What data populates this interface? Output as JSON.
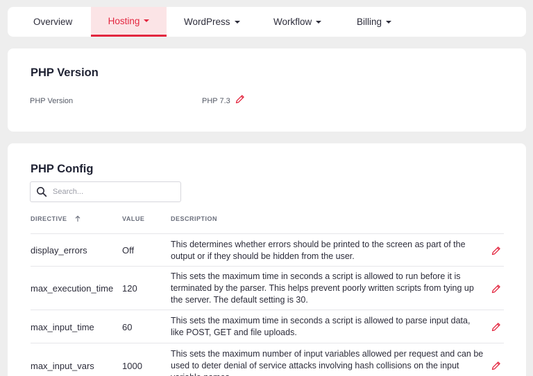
{
  "tabs": [
    {
      "label": "Overview",
      "dropdown": false,
      "active": false
    },
    {
      "label": "Hosting",
      "dropdown": true,
      "active": true
    },
    {
      "label": "WordPress",
      "dropdown": true,
      "active": false
    },
    {
      "label": "Workflow",
      "dropdown": true,
      "active": false
    },
    {
      "label": "Billing",
      "dropdown": true,
      "active": false
    }
  ],
  "php_version": {
    "title": "PHP Version",
    "label": "PHP Version",
    "value": "PHP 7.3"
  },
  "php_config": {
    "title": "PHP Config",
    "search_placeholder": "Search...",
    "columns": {
      "directive": "DIRECTIVE",
      "value": "VALUE",
      "description": "DESCRIPTION"
    },
    "sort_icon": "arrow-up-icon",
    "rows": [
      {
        "directive": "display_errors",
        "value": "Off",
        "description": "This determines whether errors should be printed to the screen as part of the output or if they should be hidden from the user."
      },
      {
        "directive": "max_execution_time",
        "value": "120",
        "description": "This sets the maximum time in seconds a script is allowed to run before it is terminated by the parser. This helps prevent poorly written scripts from tying up the server. The default setting is 30."
      },
      {
        "directive": "max_input_time",
        "value": "60",
        "description": "This sets the maximum time in seconds a script is allowed to parse input data, like POST, GET and file uploads."
      },
      {
        "directive": "max_input_vars",
        "value": "1000",
        "description": "This sets the maximum number of input variables allowed per request and can be used to deter denial of service attacks involving hash collisions on the input variable names."
      }
    ]
  },
  "colors": {
    "accent": "#e3263f",
    "accent_bg": "#fbe4e6",
    "page_bg": "#eeeeee"
  },
  "icons": {
    "edit": "pencil-icon",
    "search": "search-icon",
    "dropdown": "caret-down-icon"
  }
}
